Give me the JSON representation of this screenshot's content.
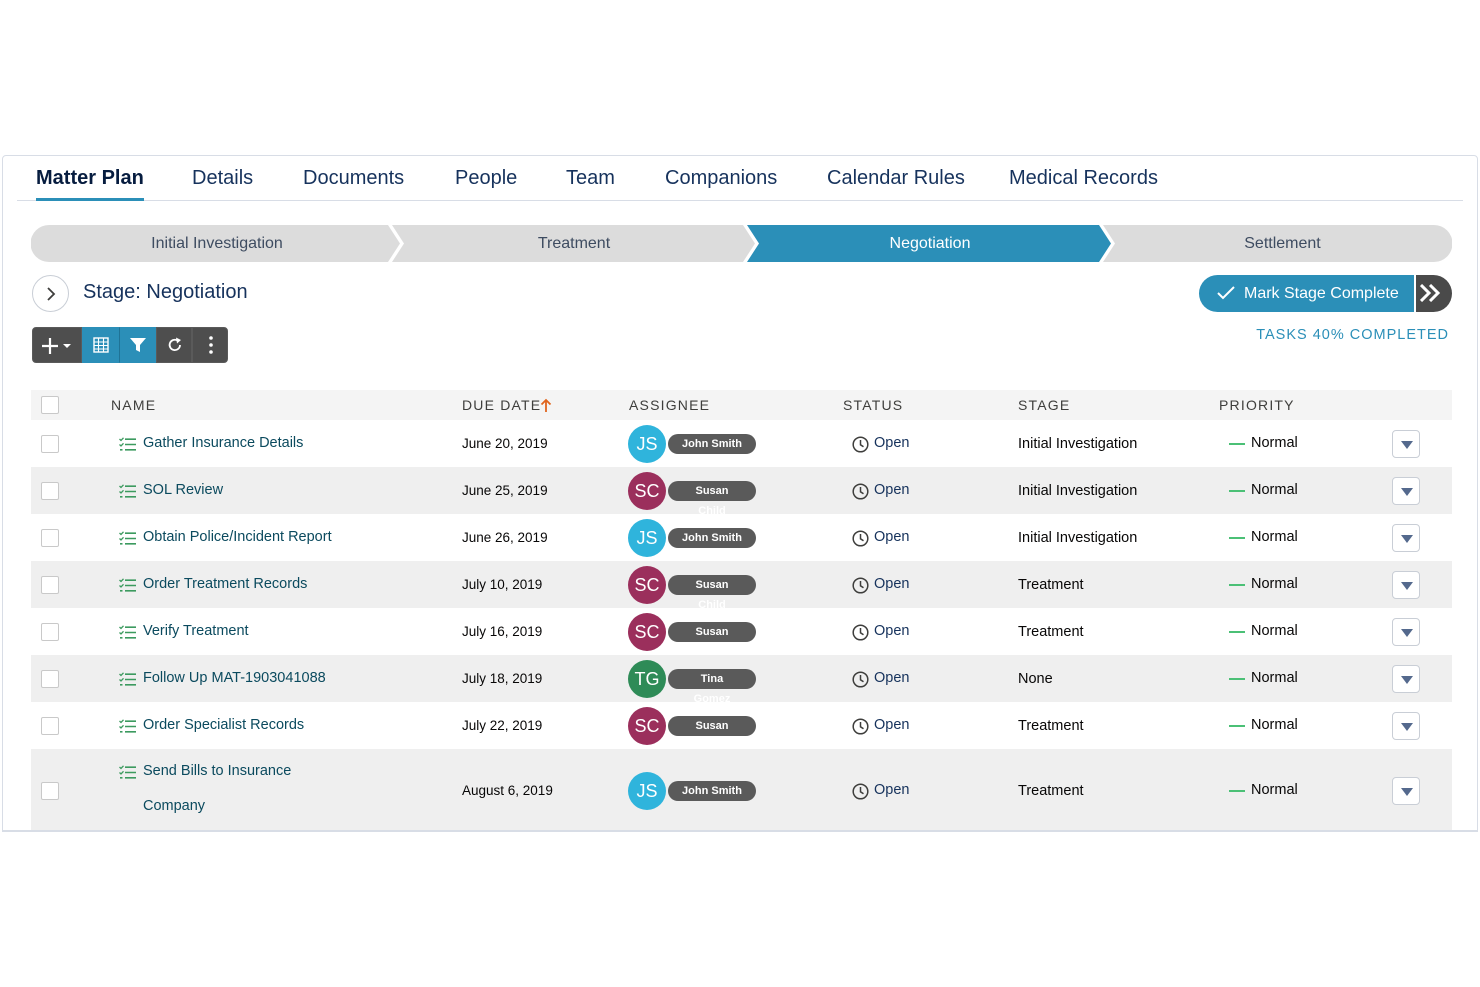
{
  "tabs": [
    {
      "label": "Matter Plan",
      "active": true
    },
    {
      "label": "Details"
    },
    {
      "label": "Documents"
    },
    {
      "label": "People"
    },
    {
      "label": "Team"
    },
    {
      "label": "Companions"
    },
    {
      "label": "Calendar Rules"
    },
    {
      "label": "Medical Records"
    }
  ],
  "path": {
    "stages": [
      "Initial Investigation",
      "Treatment",
      "Negotiation",
      "Settlement"
    ],
    "current": "Negotiation",
    "colors": {
      "current": "#2b8fb8",
      "other": "#dcdcdc"
    }
  },
  "stage_header": {
    "title": "Stage: Negotiation",
    "mark_complete_label": "Mark Stage Complete",
    "tasks_progress": "TASKS 40% COMPLETED",
    "tasks_progress_value": 0.4
  },
  "toolbar": {
    "icons": [
      "add-icon",
      "grid-icon",
      "filter-icon",
      "refresh-icon",
      "more-icon"
    ]
  },
  "table": {
    "headers": {
      "name": "NAME",
      "due_date": "DUE DATE",
      "assignee": "ASSIGNEE",
      "status": "STATUS",
      "stage": "STAGE",
      "priority": "PRIORITY"
    },
    "sort": {
      "column": "due_date",
      "direction": "ascending"
    },
    "rows": [
      {
        "name": "Gather Insurance Details",
        "due": "June 20, 2019",
        "initials": "JS",
        "assignee": "John Smith",
        "avatar_color": "#2fb4dc",
        "status": "Open",
        "stage": "Initial Investigation",
        "priority": "Normal"
      },
      {
        "name": "SOL Review",
        "due": "June 25, 2019",
        "initials": "SC",
        "assignee": "Susan Child",
        "avatar_color": "#9b2f5c",
        "status": "Open",
        "stage": "Initial Investigation",
        "priority": "Normal"
      },
      {
        "name": "Obtain Police/Incident Report",
        "due": "June 26, 2019",
        "initials": "JS",
        "assignee": "John Smith",
        "avatar_color": "#2fb4dc",
        "status": "Open",
        "stage": "Initial Investigation",
        "priority": "Normal"
      },
      {
        "name": "Order Treatment Records",
        "due": "July 10, 2019",
        "initials": "SC",
        "assignee": "Susan Child",
        "avatar_color": "#9b2f5c",
        "status": "Open",
        "stage": "Treatment",
        "priority": "Normal"
      },
      {
        "name": "Verify Treatment",
        "due": "July 16, 2019",
        "initials": "SC",
        "assignee": "Susan Child",
        "avatar_color": "#9b2f5c",
        "status": "Open",
        "stage": "Treatment",
        "priority": "Normal"
      },
      {
        "name": "Follow Up MAT-1903041088",
        "due": "July 18, 2019",
        "initials": "TG",
        "assignee": "Tina Gomez",
        "avatar_color": "#2e8b57",
        "status": "Open",
        "stage": "None",
        "priority": "Normal"
      },
      {
        "name": "Order Specialist Records",
        "due": "July 22, 2019",
        "initials": "SC",
        "assignee": "Susan Child",
        "avatar_color": "#9b2f5c",
        "status": "Open",
        "stage": "Treatment",
        "priority": "Normal"
      },
      {
        "name": "Send Bills to Insurance Company",
        "due": "August 6, 2019",
        "initials": "JS",
        "assignee": "John Smith",
        "avatar_color": "#2fb4dc",
        "status": "Open",
        "stage": "Treatment",
        "priority": "Normal"
      }
    ]
  }
}
